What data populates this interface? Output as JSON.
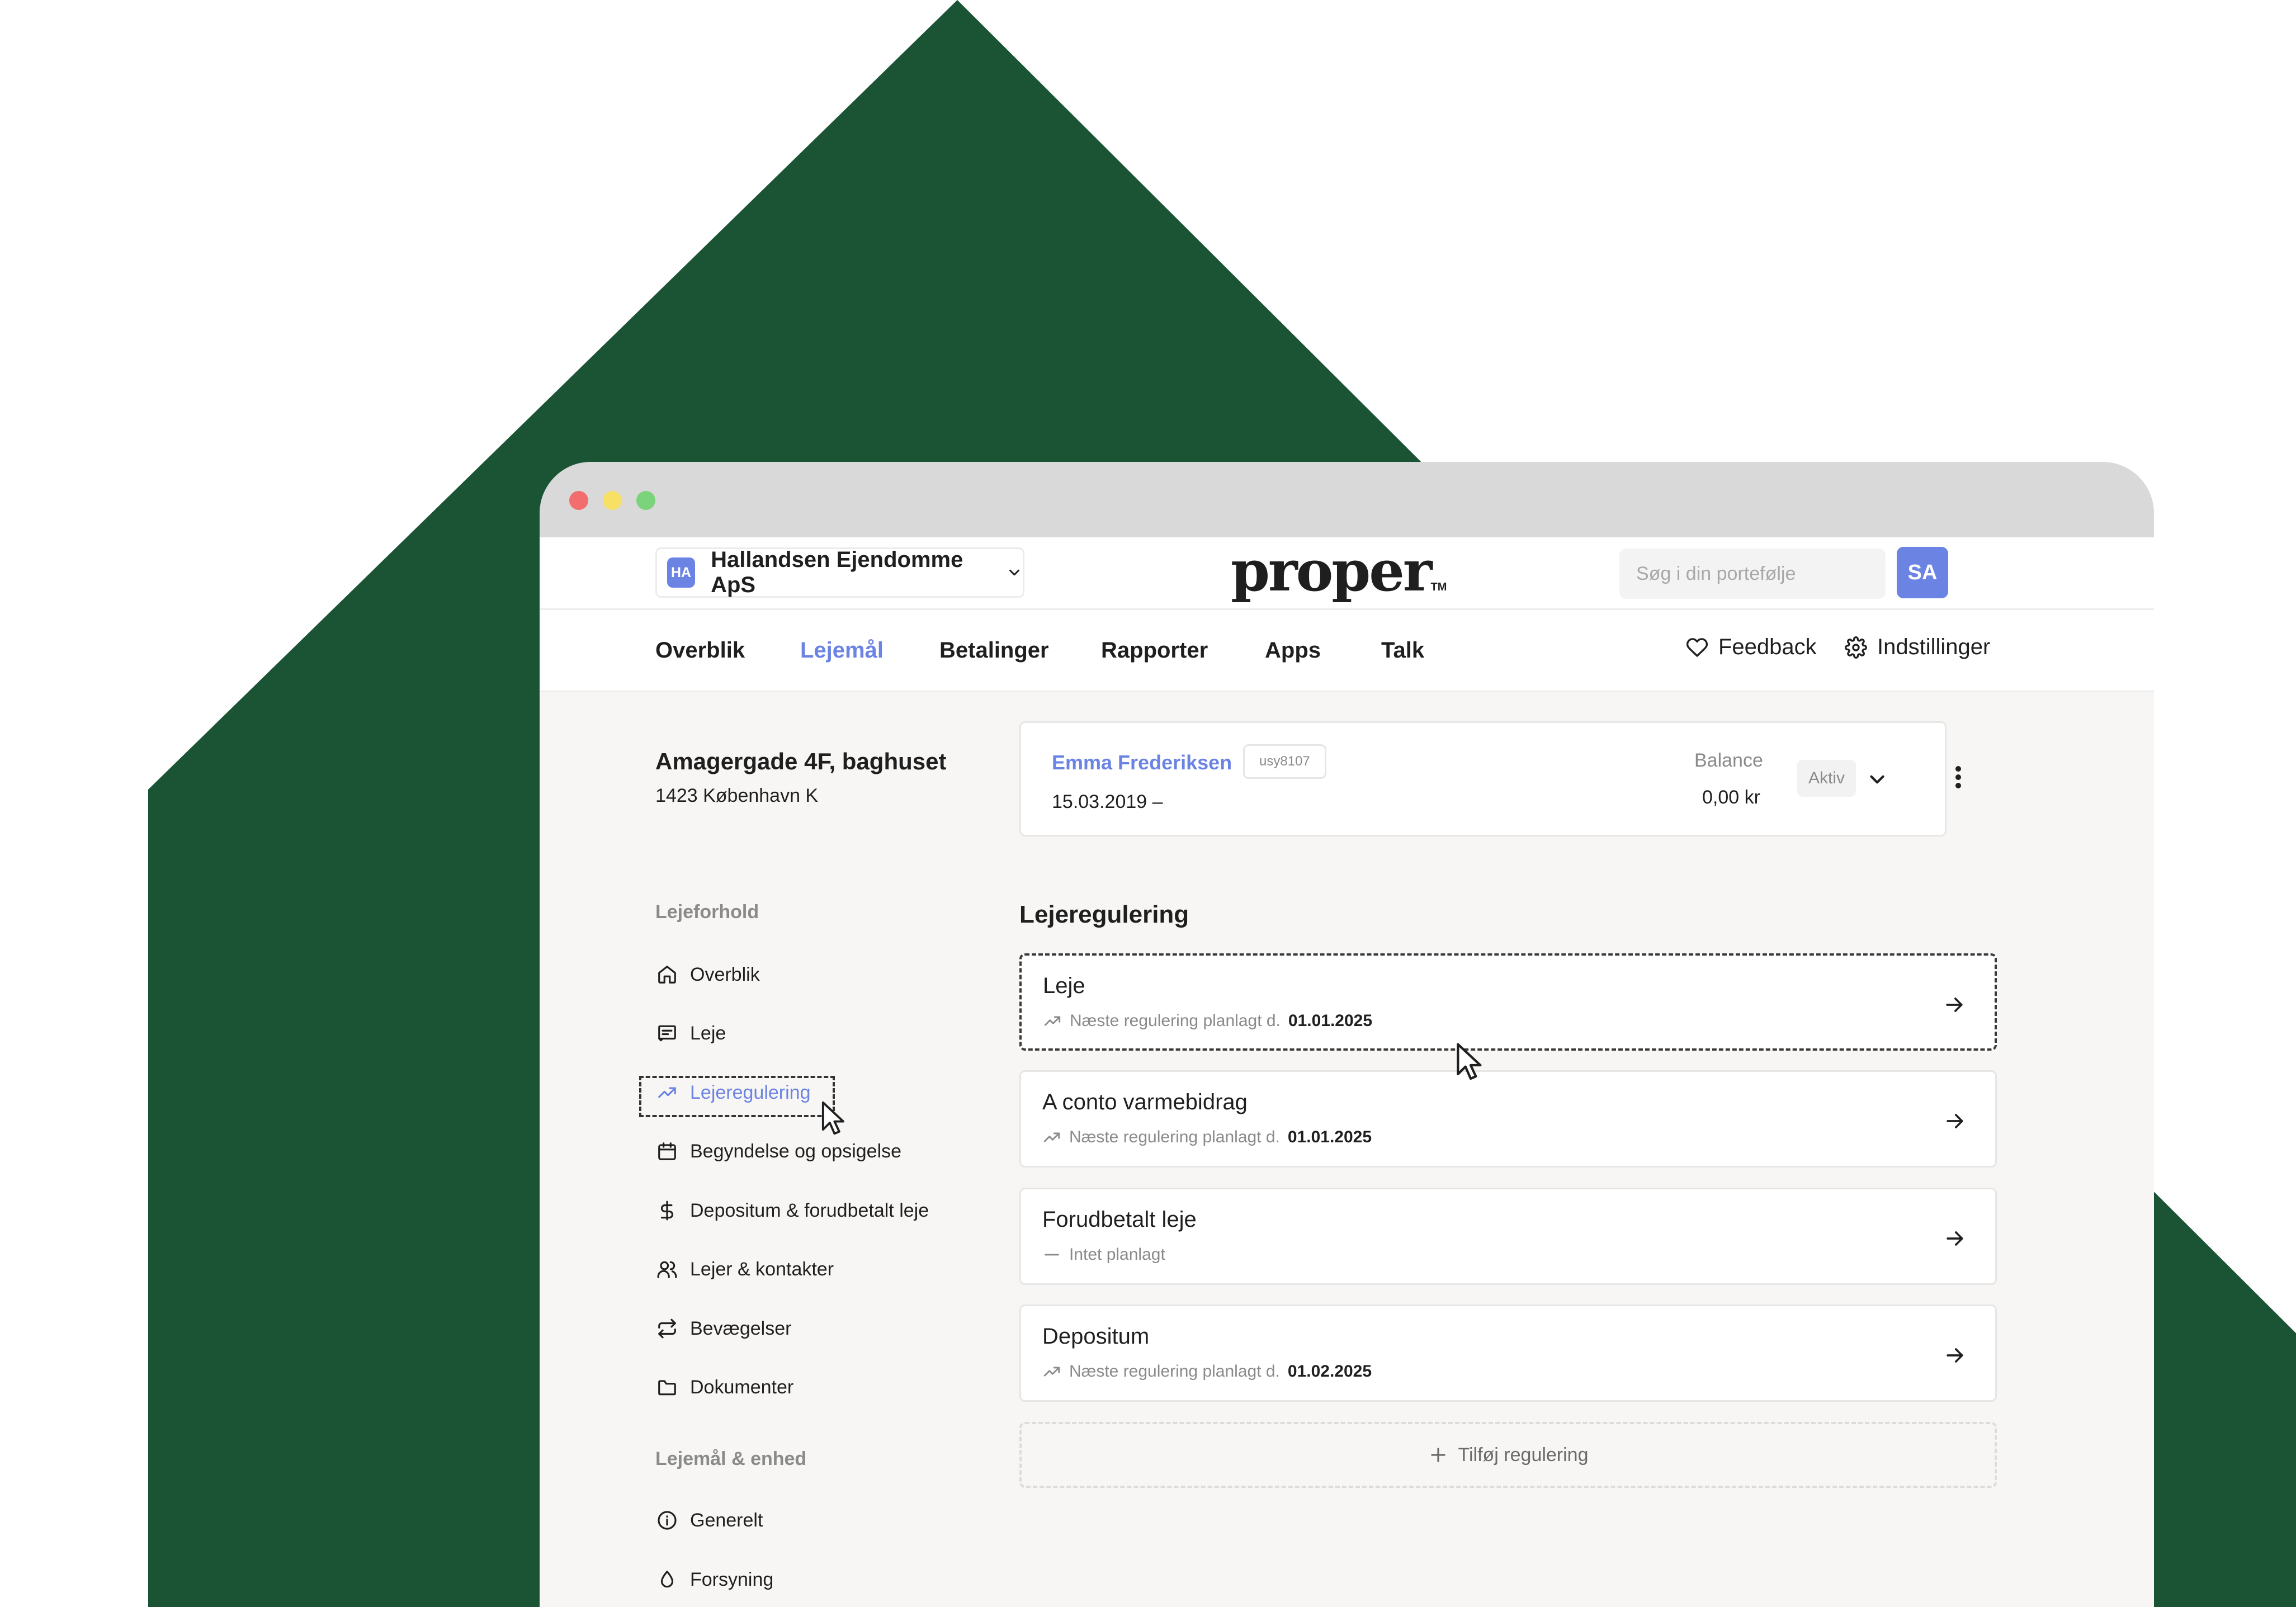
{
  "background": {
    "color": "#1a5434"
  },
  "topbar": {
    "org_badge": "HA",
    "org_name": "Hallandsen Ejendomme ApS",
    "logo_text": "proper",
    "logo_tm": "TM",
    "search_placeholder": "Søg i din portefølje",
    "user_initials": "SA"
  },
  "nav": {
    "tabs": [
      {
        "label": "Overblik"
      },
      {
        "label": "Lejemål",
        "active": true
      },
      {
        "label": "Betalinger"
      },
      {
        "label": "Rapporter"
      },
      {
        "label": "Apps"
      },
      {
        "label": "Talk"
      }
    ],
    "feedback": "Feedback",
    "settings": "Indstillinger"
  },
  "property": {
    "address": "Amagergade 4F, baghuset",
    "city": "1423 København K"
  },
  "tenant": {
    "name": "Emma Frederiksen",
    "code": "usy8107",
    "period": "15.03.2019 –",
    "balance_label": "Balance",
    "balance": "0,00 kr",
    "status": "Aktiv"
  },
  "sidebar": {
    "section1": "Lejeforhold",
    "items": [
      {
        "label": "Overblik",
        "icon": "home-icon"
      },
      {
        "label": "Leje",
        "icon": "receipt-icon"
      },
      {
        "label": "Lejeregulering",
        "icon": "trend-up-icon",
        "active": true
      },
      {
        "label": "Begyndelse og opsigelse",
        "icon": "calendar-icon"
      },
      {
        "label": "Depositum & forudbetalt leje",
        "icon": "dollar-icon"
      },
      {
        "label": "Lejer & kontakter",
        "icon": "users-icon"
      },
      {
        "label": "Bevægelser",
        "icon": "repeat-icon"
      },
      {
        "label": "Dokumenter",
        "icon": "folder-icon"
      }
    ],
    "section2": "Lejemål & enhed",
    "items2": [
      {
        "label": "Generelt",
        "icon": "info-icon"
      },
      {
        "label": "Forsyning",
        "icon": "droplet-icon"
      }
    ]
  },
  "regulation": {
    "title": "Lejeregulering",
    "cards": [
      {
        "name": "Leje",
        "sub": "Næste regulering planlagt d.",
        "date": "01.01.2025"
      },
      {
        "name": "A conto varmebidrag",
        "sub": "Næste regulering planlagt d.",
        "date": "01.01.2025"
      },
      {
        "name": "Forudbetalt leje",
        "sub": "Intet planlagt",
        "date": ""
      },
      {
        "name": "Depositum",
        "sub": "Næste regulering planlagt d.",
        "date": "01.02.2025"
      }
    ],
    "add_label": "Tilføj regulering"
  }
}
